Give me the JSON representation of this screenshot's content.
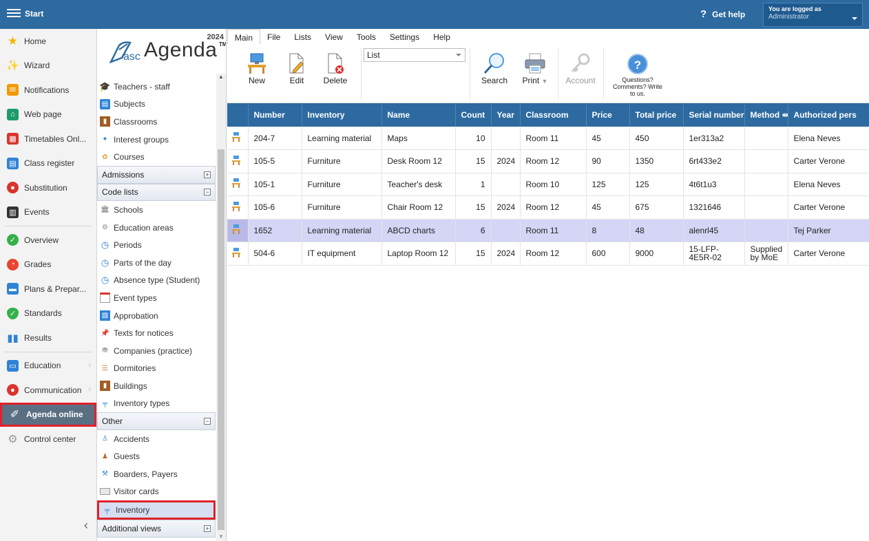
{
  "topbar": {
    "start_label": "Start",
    "help_label": "Get help",
    "logged_as_label": "You are logged as",
    "user_role": "Administrator"
  },
  "leftnav": {
    "items": [
      {
        "label": "Home",
        "icon": "star-icon",
        "color": "#f2b705"
      },
      {
        "label": "Wizard",
        "icon": "wand-icon",
        "color": "#e8442f"
      },
      {
        "label": "Notifications",
        "icon": "envelope-icon",
        "color": "#f29900"
      },
      {
        "label": "Web page",
        "icon": "house-icon",
        "color": "#1e9a6b"
      },
      {
        "label": "Timetables Onl...",
        "icon": "grid-icon",
        "color": "#d9342b"
      },
      {
        "label": "Class register",
        "icon": "book-icon",
        "color": "#2f83d6"
      },
      {
        "label": "Substitution",
        "icon": "person-icon",
        "color": "#d9342b"
      },
      {
        "label": "Events",
        "icon": "calendar-icon",
        "color": "#333333"
      },
      {
        "label": "Overview",
        "icon": "check-icon",
        "color": "#34b04a"
      },
      {
        "label": "Grades",
        "icon": "chart-icon",
        "color": "#e8442f"
      },
      {
        "label": "Plans & Prepar...",
        "icon": "briefcase-icon",
        "color": "#2f83d6"
      },
      {
        "label": "Standards",
        "icon": "shield-icon",
        "color": "#34b04a"
      },
      {
        "label": "Results",
        "icon": "bar-chart-icon",
        "color": "#2f83d6"
      },
      {
        "label": "Education",
        "icon": "open-book-icon",
        "color": "#2f83d6"
      },
      {
        "label": "Communication",
        "icon": "chat-icon",
        "color": "#d9342b"
      },
      {
        "label": "Agenda online",
        "icon": "agenda-pen-icon",
        "color": "#ffffff"
      },
      {
        "label": "Control center",
        "icon": "gear-icon",
        "color": "#999999"
      }
    ]
  },
  "panel2": {
    "logo": {
      "year": "2024",
      "asc": "asc",
      "agenda": "Agenda",
      "tm": "TM"
    },
    "top_items": [
      "Teachers - staff",
      "Subjects",
      "Classrooms",
      "Interest groups",
      "Courses"
    ],
    "admissions_header": "Admissions",
    "codelists_header": "Code lists",
    "code_items": [
      "Schools",
      "Education areas",
      "Periods",
      "Parts of the day",
      "Absence type (Student)",
      "Event types",
      "Approbation",
      "Texts for notices",
      "Companies (practice)",
      "Dormitories",
      "Buildings",
      "Inventory types"
    ],
    "other_header": "Other",
    "other_items": [
      "Accidents",
      "Guests",
      "Boarders, Payers",
      "Visitor cards",
      "Inventory"
    ],
    "additional_header": "Additional views"
  },
  "ribbon": {
    "tabs": [
      "Main",
      "File",
      "Lists",
      "View",
      "Tools",
      "Settings",
      "Help"
    ],
    "new_label": "New",
    "edit_label": "Edit",
    "delete_label": "Delete",
    "view_select": "List",
    "search_label": "Search",
    "print_label": "Print",
    "account_label": "Account",
    "questions_line1": "Questions?",
    "questions_line2": "Comments? Write",
    "questions_line3": "to us."
  },
  "table": {
    "columns": [
      "",
      "Number",
      "Inventory",
      "Name",
      "Count",
      "Year",
      "Classroom",
      "Price",
      "Total price",
      "Serial number",
      "Method",
      "Authorized pers"
    ],
    "rows": [
      {
        "number": "204-7",
        "inventory": "Learning material",
        "name": "Maps",
        "count": "10",
        "year": "",
        "classroom": "Room 11",
        "price": "45",
        "total": "450",
        "serial": "1er313a2",
        "method": "",
        "person": "Elena Neves"
      },
      {
        "number": "105-5",
        "inventory": "Furniture",
        "name": "Desk Room 12",
        "count": "15",
        "year": "2024",
        "classroom": "Room 12",
        "price": "90",
        "total": "1350",
        "serial": "6rt433e2",
        "method": "",
        "person": "Carter Verone"
      },
      {
        "number": "105-1",
        "inventory": "Furniture",
        "name": "Teacher's desk",
        "count": "1",
        "year": "",
        "classroom": "Room 10",
        "price": "125",
        "total": "125",
        "serial": "4t6t1u3",
        "method": "",
        "person": "Elena Neves"
      },
      {
        "number": "105-6",
        "inventory": "Furniture",
        "name": "Chair Room 12",
        "count": "15",
        "year": "2024",
        "classroom": "Room 12",
        "price": "45",
        "total": "675",
        "serial": "1321646",
        "method": "",
        "person": "Carter Verone"
      },
      {
        "number": "1652",
        "inventory": "Learning material",
        "name": "ABCD charts",
        "count": "6",
        "year": "",
        "classroom": "Room 11",
        "price": "8",
        "total": "48",
        "serial": "alenrl45",
        "method": "",
        "person": "Tej Parker"
      },
      {
        "number": "504-6",
        "inventory": "IT equipment",
        "name": "Laptop Room 12",
        "count": "15",
        "year": "2024",
        "classroom": "Room 12",
        "price": "600",
        "total": "9000",
        "serial": "15-LFP-4E5R-02",
        "method": "Supplied by MoE",
        "person": "Carter Verone"
      }
    ]
  }
}
